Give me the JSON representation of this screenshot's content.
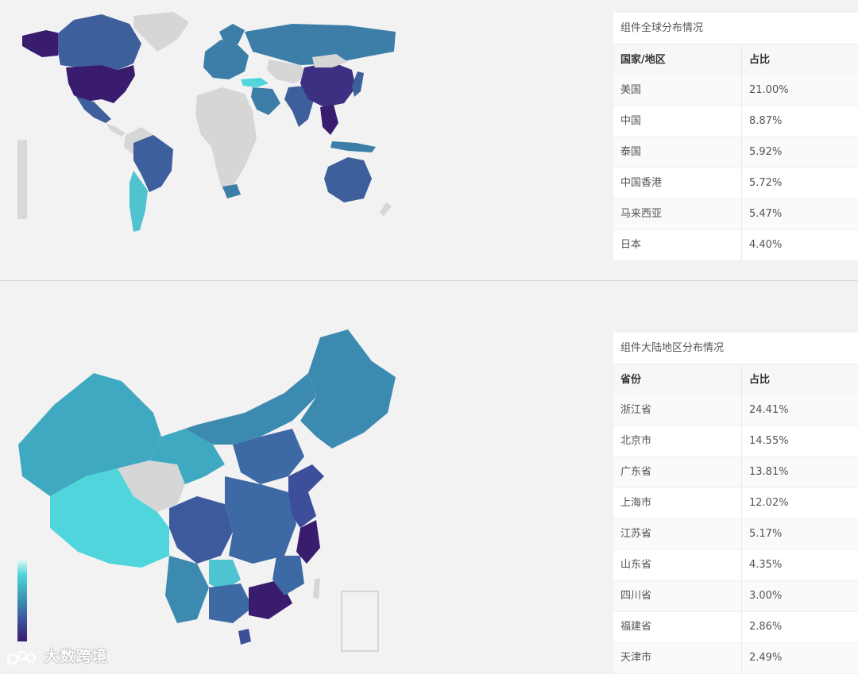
{
  "world_panel": {
    "title": "组件全球分布情况",
    "col_region": "国家/地区",
    "col_share": "占比",
    "rows": [
      {
        "name": "美国",
        "share": "21.00%"
      },
      {
        "name": "中国",
        "share": "8.87%"
      },
      {
        "name": "泰国",
        "share": "5.92%"
      },
      {
        "name": "中国香港",
        "share": "5.72%"
      },
      {
        "name": "马来西亚",
        "share": "5.47%"
      },
      {
        "name": "日本",
        "share": "4.40%"
      }
    ]
  },
  "china_panel": {
    "title": "组件大陆地区分布情况",
    "col_region": "省份",
    "col_share": "占比",
    "rows": [
      {
        "name": "浙江省",
        "share": "24.41%"
      },
      {
        "name": "北京市",
        "share": "14.55%"
      },
      {
        "name": "广东省",
        "share": "13.81%"
      },
      {
        "name": "上海市",
        "share": "12.02%"
      },
      {
        "name": "江苏省",
        "share": "5.17%"
      },
      {
        "name": "山东省",
        "share": "4.35%"
      },
      {
        "name": "四川省",
        "share": "3.00%"
      },
      {
        "name": "福建省",
        "share": "2.86%"
      },
      {
        "name": "天津市",
        "share": "2.49%"
      }
    ]
  },
  "colors": {
    "scale_high": "#3a1c6e",
    "scale_mid": "#3d7ea8",
    "scale_low": "#4fd5db",
    "no_data": "#d6d6d6"
  },
  "watermark": {
    "text": "大数跨境"
  }
}
